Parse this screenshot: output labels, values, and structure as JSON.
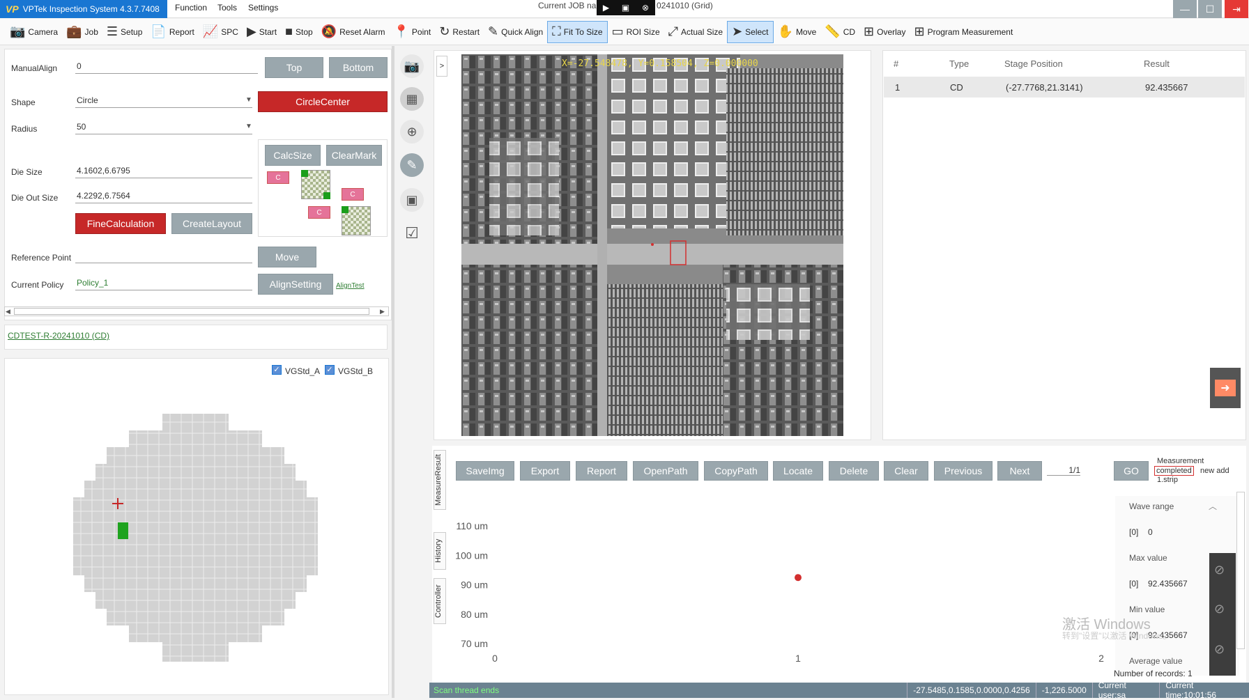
{
  "app": {
    "title": "VPTek Inspection System 4.3.7.7408",
    "logo": "VP"
  },
  "menu": [
    "Function",
    "Tools",
    "Settings"
  ],
  "job_title_left": "Current JOB na",
  "job_title_right": "0241010 (Grid)",
  "toolbar": [
    {
      "icon": "camera-icon",
      "glyph": "📷",
      "label": "Camera"
    },
    {
      "icon": "job-icon",
      "glyph": "💼",
      "label": "Job"
    },
    {
      "icon": "setup-icon",
      "glyph": "☰",
      "label": "Setup"
    },
    {
      "icon": "report-icon",
      "glyph": "📄",
      "label": "Report"
    },
    {
      "icon": "spc-icon",
      "glyph": "📈",
      "label": "SPC"
    },
    {
      "icon": "start-icon",
      "glyph": "▶",
      "label": "Start"
    },
    {
      "icon": "stop-icon",
      "glyph": "■",
      "label": "Stop"
    },
    {
      "icon": "reset-alarm-icon",
      "glyph": "🔕",
      "label": "Reset Alarm"
    },
    {
      "icon": "point-icon",
      "glyph": "📍",
      "label": "Point"
    },
    {
      "icon": "restart-icon",
      "glyph": "↻",
      "label": "Restart"
    },
    {
      "icon": "quick-align-icon",
      "glyph": "✎",
      "label": "Quick Align"
    },
    {
      "icon": "fit-to-size-icon",
      "glyph": "⛶",
      "label": "Fit To Size",
      "selected": true
    },
    {
      "icon": "roi-size-icon",
      "glyph": "▭",
      "label": "ROI Size"
    },
    {
      "icon": "actual-size-icon",
      "glyph": "⤢",
      "label": "Actual Size"
    },
    {
      "icon": "select-icon",
      "glyph": "➤",
      "label": "Select",
      "selected": true
    },
    {
      "icon": "move-icon",
      "glyph": "✋",
      "label": "Move"
    },
    {
      "icon": "cd-icon",
      "glyph": "📏",
      "label": "CD"
    },
    {
      "icon": "overlay-icon",
      "glyph": "⊞",
      "label": "Overlay"
    },
    {
      "icon": "program-measurement-icon",
      "glyph": "⊞",
      "label": "Program Measurement"
    }
  ],
  "left": {
    "manual_align_label": "ManualAlign",
    "manual_align_value": "0",
    "top_btn": "Top",
    "bottom_btn": "Bottom",
    "shape_label": "Shape",
    "shape_value": "Circle",
    "circle_center_btn": "CircleCenter",
    "radius_label": "Radius",
    "radius_value": "50",
    "calc_size_btn": "CalcSize",
    "clear_mark_btn": "ClearMark",
    "die_size_label": "Die Size",
    "die_size_value": "4.1602,6.6795",
    "die_out_size_label": "Die Out Size",
    "die_out_size_value": "4.2292,6.7564",
    "fine_calc_btn": "FineCalculation",
    "create_layout_btn": "CreateLayout",
    "ref_point_label": "Reference Point",
    "ref_point_value": "",
    "move_btn": "Move",
    "policy_label": "Current Policy",
    "policy_value": "Policy_1",
    "align_setting_btn": "AlignSetting",
    "align_test_link": "AlignTest",
    "chip_label": "C",
    "job_link": "CDTEST-R-20241010 (CD)",
    "vgstd_a": "VGStd_A",
    "vgstd_b": "VGStd_B"
  },
  "image": {
    "coord_text": "X=-27.548478, Y=0.158504, Z=0.000000"
  },
  "table": {
    "headers": [
      "#",
      "Type",
      "Stage Position",
      "Result"
    ],
    "rows": [
      [
        "1",
        "CD",
        "(-27.7768,21.3141)",
        "92.435667"
      ]
    ]
  },
  "bottom": {
    "tabs": [
      "MeasureResult",
      "History",
      "Controller"
    ],
    "buttons": [
      "SaveImg",
      "Export",
      "Report",
      "OpenPath",
      "CopyPath",
      "Locate",
      "Delete",
      "Clear",
      "Previous",
      "Next"
    ],
    "page": "1/1",
    "go_btn": "GO",
    "status_line1": "Measurement",
    "status_completed": "completed",
    "status_line2_rest": "new add",
    "status_line3": "1.strip",
    "wave_range_label": "Wave range",
    "wave_range_idx": "[0]",
    "wave_range_value": "0",
    "max_label": "Max value",
    "max_idx": "[0]",
    "max_value": "92.435667",
    "min_label": "Min value",
    "min_idx": "[0]",
    "min_value": "92.435667",
    "avg_label": "Average value",
    "records": "Number of records: 1"
  },
  "chart_data": {
    "type": "scatter",
    "y_ticks": [
      "110 um",
      "100 um",
      "90 um",
      "80 um",
      "70 um"
    ],
    "x_ticks": [
      "0",
      "1",
      "2"
    ],
    "xlim": [
      0,
      2
    ],
    "ylim": [
      70,
      110
    ],
    "points": [
      {
        "x": 1,
        "y": 92.435667
      }
    ],
    "point_color": "#d32f2f"
  },
  "status": {
    "left": "Scan thread ends",
    "coords": "-27.5485,0.1585,0.0000,0.4256",
    "pos2": "-1,226.5000",
    "user": "Current user:sa",
    "time": "Current time:10:01:56"
  },
  "watermark": {
    "line1": "激活 Windows",
    "line2": "转到\"设置\"以激活 Windows。"
  }
}
